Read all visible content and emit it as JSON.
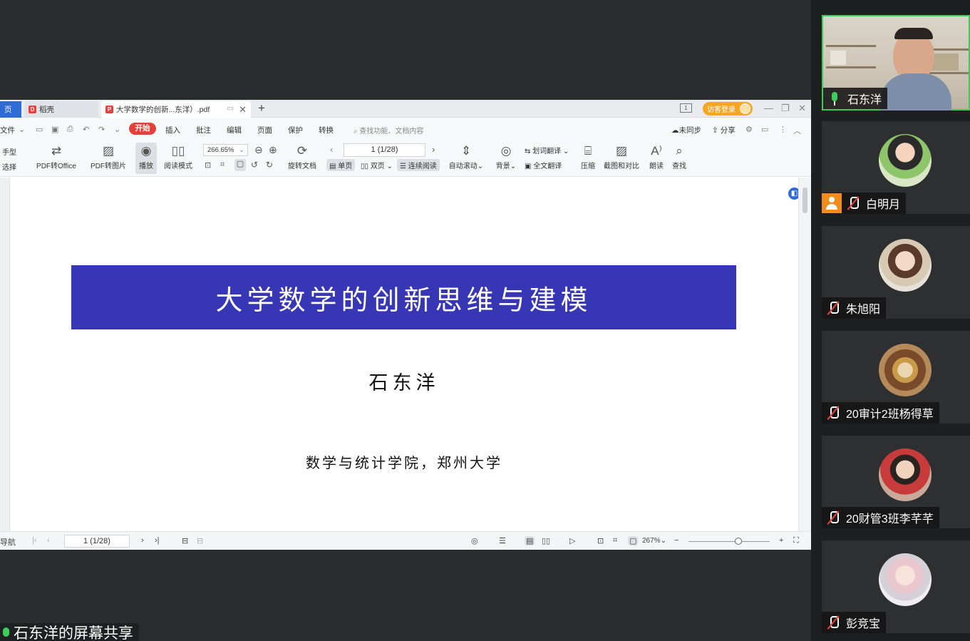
{
  "wps": {
    "tabs": [
      {
        "label": "页"
      },
      {
        "label": "稻壳"
      },
      {
        "label": "大学数学的创新...东洋）.pdf"
      }
    ],
    "login_label": "访客登录",
    "pagebox_icon": "1",
    "menus": [
      "文件",
      "开始",
      "插入",
      "批注",
      "编辑",
      "页面",
      "保护",
      "转换"
    ],
    "search_placeholder": "查找功能、文档内容",
    "right_menu": [
      "未同步",
      "分享"
    ],
    "ribbon": {
      "hand": "手型",
      "select": "选择",
      "pdf_to_office": "PDF转Office",
      "pdf_to_image": "PDF转图片",
      "play": "播放",
      "read_mode": "阅读模式",
      "zoom_value": "266.65%",
      "rotate_doc": "旋转文档",
      "page_value": "1 (1/28)",
      "single_page": "单页",
      "double_page": "双页",
      "continuous": "连续阅读",
      "auto_scroll": "自动滚动",
      "background": "背景",
      "word_translate": "划词翻译",
      "full_translate": "全文翻译",
      "compress": "压缩",
      "screenshot_compare": "截图和对比",
      "read_aloud": "朗读",
      "find": "查找"
    },
    "document": {
      "title": "大学数学的创新思维与建模",
      "author": "石东洋",
      "affiliation": "数学与统计学院，郑州大学"
    },
    "statusbar": {
      "nav_label": "导航",
      "page_value": "1 (1/28)",
      "zoom_value": "267%"
    }
  },
  "share_label": "石东洋的屏幕共享",
  "participants": [
    {
      "name": "石东洋",
      "state": "speaking"
    },
    {
      "name": "白明月",
      "state": "muted"
    },
    {
      "name": "朱旭阳",
      "state": "muted"
    },
    {
      "name": "20审计2班杨得草",
      "state": "muted"
    },
    {
      "name": "20财管3班李芊芊",
      "state": "muted"
    },
    {
      "name": "彭竞宝",
      "state": "muted"
    }
  ],
  "colors": {
    "title_band": "#3736b4",
    "start_tab": "#e2423b",
    "login": "#f5a623",
    "speaking": "#3ccc5a"
  }
}
